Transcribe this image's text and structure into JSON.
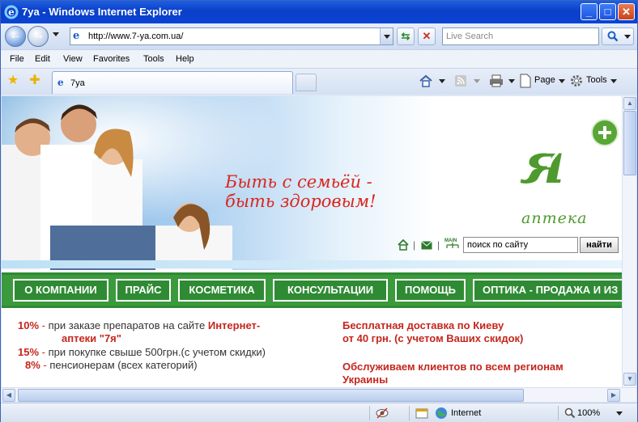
{
  "window": {
    "title": "7ya - Windows Internet Explorer",
    "minimize": "_",
    "maximize": "□",
    "close": "✕"
  },
  "addressbar": {
    "url": "http://www.7-ya.com.ua/",
    "search_placeholder": "Live Search"
  },
  "menu": [
    "File",
    "Edit",
    "View",
    "Favorites",
    "Tools",
    "Help"
  ],
  "tab": {
    "label": "7ya"
  },
  "toolbar": {
    "page_label": "Page",
    "tools_label": "Tools"
  },
  "site": {
    "slogan_line1": "Быть с семьёй -",
    "slogan_line2": "быть здоровым!",
    "logo_number": "7",
    "logo_letter": "я",
    "logo_caption": "аптека",
    "search_value": "поиск по сайту",
    "search_button": "найти",
    "nav": [
      "О КОМПАНИИ",
      "ПРАЙС",
      "КОСМЕТИКА",
      "КОНСУЛЬТАЦИИ",
      "ПОМОЩЬ",
      "ОПТИКА - ПРОДАЖА И ИЗ"
    ],
    "promo_left": [
      {
        "pct": "10%",
        "dash": "-",
        "text": "при заказе препаратов на сайте",
        "bold": "Интернет-"
      },
      {
        "pct": "",
        "dash": "",
        "text": "",
        "bold": "аптеки \"7я\""
      },
      {
        "pct": "15%",
        "dash": "-",
        "text": "при покупке свыше 500грн.(с учетом скидки)",
        "bold": ""
      },
      {
        "pct": "8%",
        "dash": "-",
        "text": "пенсионерам (всех категорий)",
        "bold": ""
      }
    ],
    "promo_right": [
      "Бесплатная доставка по Киеву",
      "от 40 грн. (с учетом Ваших скидок)",
      "Обслуживаем клиентов по всем регионам",
      "Украины"
    ]
  },
  "statusbar": {
    "zone": "Internet",
    "zoom": "100%"
  }
}
